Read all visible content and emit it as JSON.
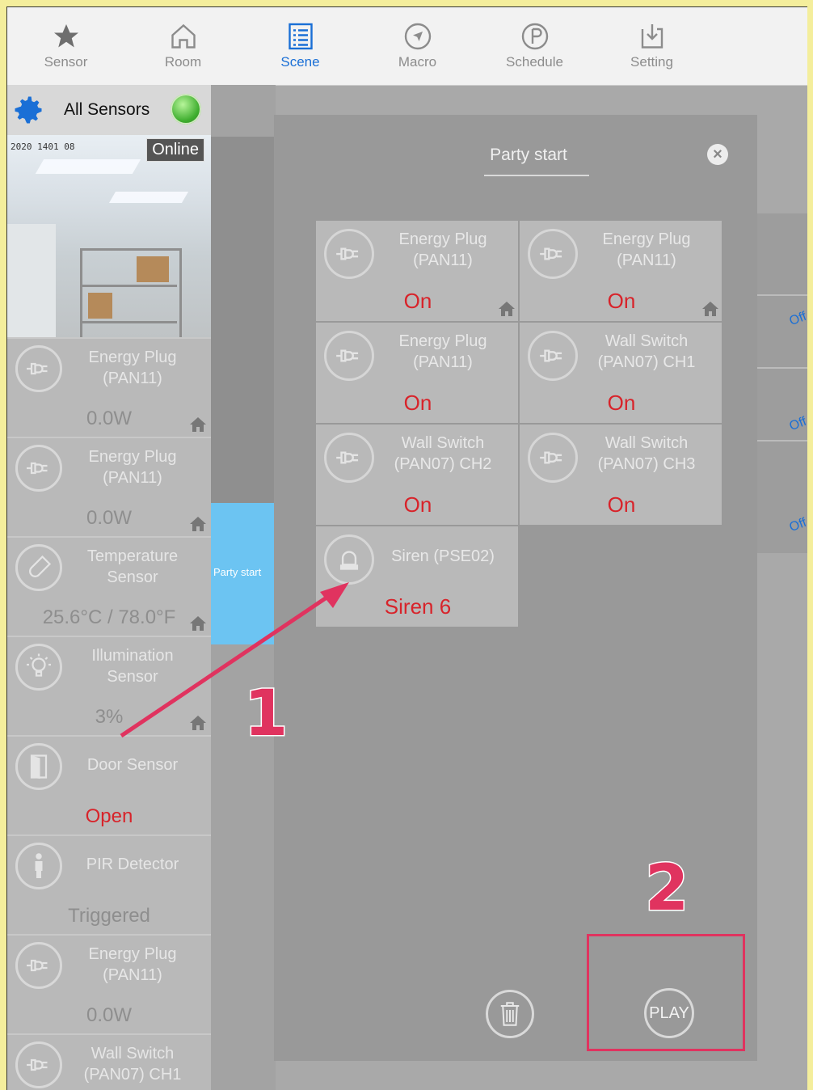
{
  "nav": {
    "items": [
      {
        "label": "Sensor",
        "icon": "star-icon"
      },
      {
        "label": "Room",
        "icon": "house-icon"
      },
      {
        "label": "Scene",
        "icon": "list-icon",
        "active": true
      },
      {
        "label": "Macro",
        "icon": "compass-icon"
      },
      {
        "label": "Schedule",
        "icon": "clock-icon"
      },
      {
        "label": "Setting",
        "icon": "download-icon"
      }
    ]
  },
  "sidebar": {
    "title": "All Sensors",
    "camera_status": "Online",
    "camera_timestamp": "2020 1401 08",
    "tiles": [
      {
        "name": "Energy Plug\n(PAN11)",
        "value": "0.0W",
        "icon": "plug-icon"
      },
      {
        "name": "Energy Plug\n(PAN11)",
        "value": "0.0W",
        "icon": "plug-icon"
      },
      {
        "name": "Temperature\nSensor",
        "value": "25.6°C / 78.0°F",
        "icon": "thermometer-icon"
      },
      {
        "name": "Illumination\nSensor",
        "value": "3%",
        "icon": "bulb-icon"
      },
      {
        "name": "Door Sensor",
        "value": "Open",
        "icon": "door-icon",
        "alert": true
      },
      {
        "name": "PIR Detector",
        "value": "Triggered",
        "icon": "person-icon"
      },
      {
        "name": "Energy Plug\n(PAN11)",
        "value": "0.0W",
        "icon": "plug-icon"
      },
      {
        "name": "Wall Switch\n(PAN07) CH1",
        "value": "",
        "icon": "plug-icon"
      }
    ]
  },
  "background": {
    "scene_label": "Party start"
  },
  "right_edge": {
    "states": [
      "Off",
      "Off",
      "Off"
    ]
  },
  "modal": {
    "title": "Party start",
    "close": "×",
    "devices": [
      {
        "name": "Energy Plug\n(PAN11)",
        "state": "On",
        "icon": "plug-icon"
      },
      {
        "name": "Energy Plug\n(PAN11)",
        "state": "On",
        "icon": "plug-icon"
      },
      {
        "name": "Energy Plug\n(PAN11)",
        "state": "On",
        "icon": "plug-icon"
      },
      {
        "name": "Wall Switch\n(PAN07) CH1",
        "state": "On",
        "icon": "plug-icon"
      },
      {
        "name": "Wall Switch\n(PAN07) CH2",
        "state": "On",
        "icon": "plug-icon"
      },
      {
        "name": "Wall Switch\n(PAN07) CH3",
        "state": "On",
        "icon": "plug-icon"
      },
      {
        "name": "Siren (PSE02)",
        "state": "Siren 6",
        "icon": "siren-icon"
      }
    ],
    "play_label": "PLAY"
  },
  "annotations": {
    "step1": "1",
    "step2": "2"
  },
  "colors": {
    "accent": "#1a6fd6",
    "alert": "#d8232a",
    "annotation": "#e0335f"
  }
}
